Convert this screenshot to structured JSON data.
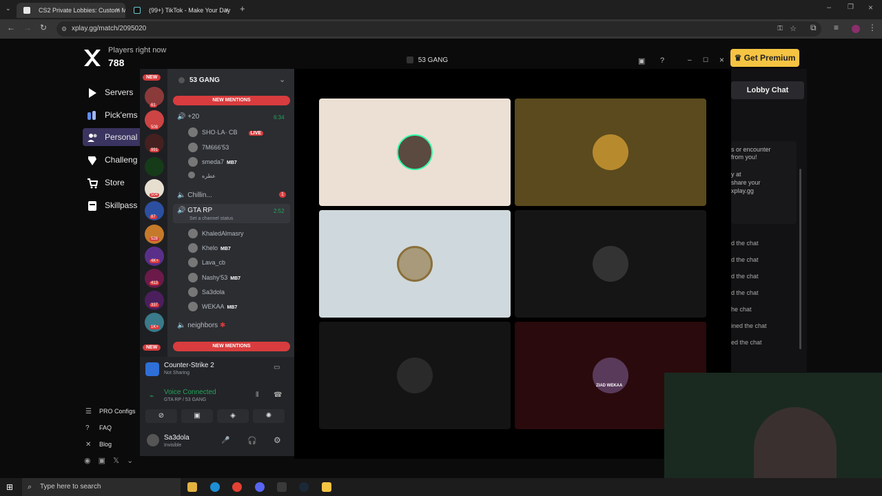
{
  "browser": {
    "tabs": [
      {
        "title": "CS2 Private Lobbies: Custom M"
      },
      {
        "title": "(99+) TikTok - Make Your Day"
      }
    ],
    "url": "xplay.gg/match/2095020"
  },
  "site": {
    "players_label": "Players right now",
    "players_count": "788",
    "nav": [
      "Servers",
      "Pick'ems",
      "Personal",
      "Challeng",
      "Store",
      "Skillpass"
    ],
    "footer_links": [
      "PRO Configs",
      "FAQ",
      "Blog"
    ],
    "premium_label": "Get Premium",
    "lobby_chat_label": "Lobby Chat",
    "chat_snippet": [
      "s or encounter",
      "from you!",
      "y at",
      "share your",
      "xplay.gg"
    ],
    "chat_lines": [
      "d the chat",
      "d the chat",
      "d the chat",
      "d the chat",
      "he chat",
      "ined the chat",
      "ed the chat"
    ]
  },
  "discord": {
    "window_title": "53 GANG",
    "server_name": "53 GANG",
    "new_badge": "NEW",
    "new_mentions": "NEW MENTIONS",
    "server_badges": [
      "61",
      "508",
      "991",
      "504",
      "87",
      "528",
      "4K+",
      "413",
      "337",
      "1K+"
    ],
    "channel_plus20": "+20",
    "channel_plus20_time": "6:34",
    "channel_users_top": [
      {
        "name": "SHO·LA· CB",
        "live": "LIVE"
      },
      {
        "name": "7M666'53"
      },
      {
        "name": "smeda7",
        "tag": "MB7"
      },
      {
        "name": "عطره"
      }
    ],
    "channel_chillin": "Chillin...",
    "chillin_badge": "1",
    "channel_gtarp": "GTA RP",
    "gtarp_time": "2:52",
    "gtarp_status": "Set a channel status",
    "gtarp_users": [
      {
        "name": "KhaledAlmasry"
      },
      {
        "name": "Khelo",
        "tag": "MB7"
      },
      {
        "name": "Lava_cb"
      },
      {
        "name": "Nashy'53",
        "tag": "MB7"
      },
      {
        "name": "Sa3dola"
      },
      {
        "name": "WEKAA",
        "tag": "MB7"
      }
    ],
    "channel_neighbors": "neighbors",
    "activity_game": "Counter-Strike 2",
    "activity_status": "Not Sharing",
    "voice_connected": "Voice Connected",
    "voice_channel": "GTA RP / 53 GANG",
    "self_name": "Sa3dola",
    "self_status": "Invisible",
    "tile_label": "ZIAD WEKAA"
  },
  "taskbar": {
    "search_placeholder": "Type here to search"
  },
  "colors": {
    "accent": "#5865f2",
    "mention_red": "#d83c3e",
    "voice_green": "#23a55a",
    "premium": "#f5c443"
  }
}
